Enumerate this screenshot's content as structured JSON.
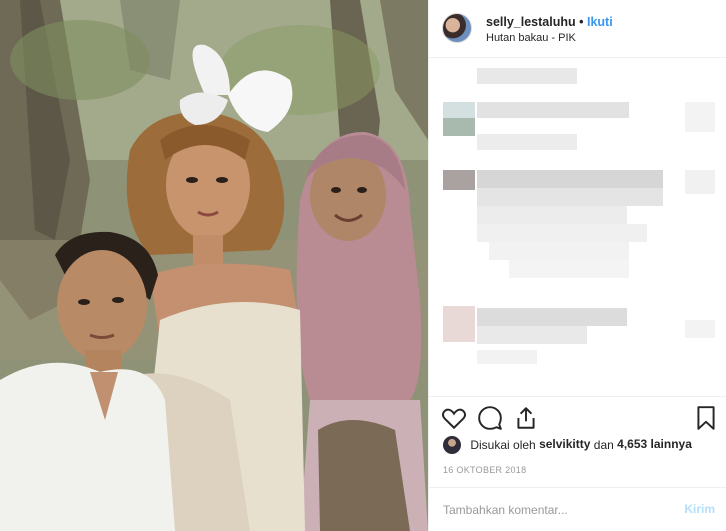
{
  "post": {
    "username": "selly_lestaluhu",
    "separator": "•",
    "follow_label": "Ikuti",
    "location": "Hutan bakau - PIK"
  },
  "likes": {
    "prefix": "Disukai oleh",
    "liker": "selvikitty",
    "connector": "dan",
    "count_text": "4,653 lainnya"
  },
  "date": "16 OKTOBER 2018",
  "comment": {
    "placeholder": "Tambahkan komentar...",
    "post_label": "Kirim"
  },
  "colors": {
    "link": "#3897f0",
    "post_disabled": "#b2dffc",
    "border": "#efefef",
    "muted": "#999999"
  },
  "icons": [
    "heart-icon",
    "comment-icon",
    "share-icon",
    "bookmark-icon"
  ]
}
